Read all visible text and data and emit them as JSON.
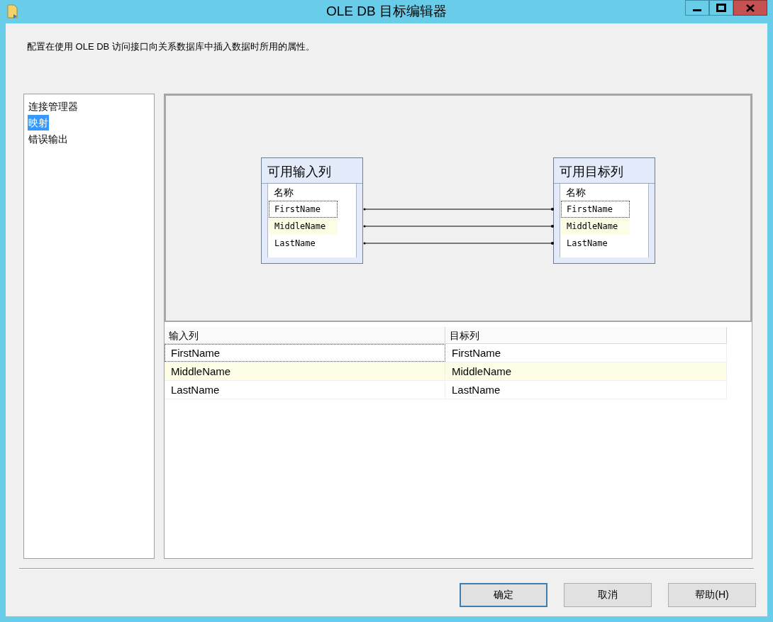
{
  "window": {
    "title": "OLE DB 目标编辑器"
  },
  "description": "配置在使用 OLE DB 访问接口向关系数据库中插入数据时所用的属性。",
  "sidebar": {
    "items": [
      {
        "label": "连接管理器",
        "selected": false
      },
      {
        "label": "映射",
        "selected": true
      },
      {
        "label": "错误输出",
        "selected": false
      }
    ]
  },
  "diagram": {
    "tables": [
      {
        "title": "可用输入列",
        "header": "名称",
        "columns": [
          {
            "name": "FirstName",
            "focused": true,
            "highlighted": false
          },
          {
            "name": "MiddleName",
            "focused": false,
            "highlighted": true
          },
          {
            "name": "LastName",
            "focused": false,
            "highlighted": false
          }
        ]
      },
      {
        "title": "可用目标列",
        "header": "名称",
        "columns": [
          {
            "name": "FirstName",
            "focused": true,
            "highlighted": false
          },
          {
            "name": "MiddleName",
            "focused": false,
            "highlighted": true
          },
          {
            "name": "LastName",
            "focused": false,
            "highlighted": false
          }
        ]
      }
    ]
  },
  "mapping_table": {
    "columns": [
      "输入列",
      "目标列"
    ],
    "rows": [
      {
        "cells": [
          "FirstName",
          "FirstName"
        ],
        "focused": true,
        "highlighted": false
      },
      {
        "cells": [
          "MiddleName",
          "MiddleName"
        ],
        "focused": false,
        "highlighted": true
      },
      {
        "cells": [
          "LastName",
          "LastName"
        ],
        "focused": false,
        "highlighted": false
      }
    ]
  },
  "buttons": [
    {
      "label": "确定",
      "default": true
    },
    {
      "label": "取消",
      "default": false
    },
    {
      "label": "帮助(H)",
      "default": false
    }
  ]
}
